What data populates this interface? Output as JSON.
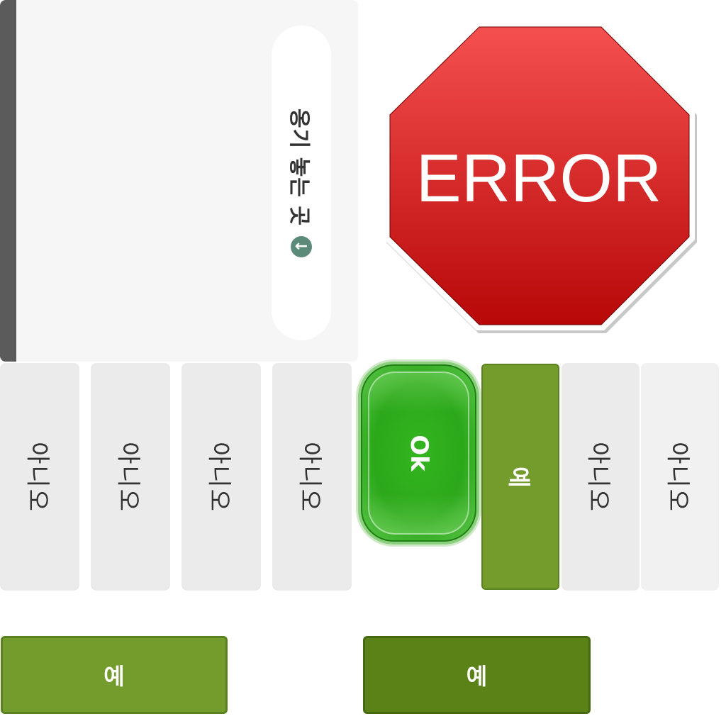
{
  "drop_zone": {
    "label": "옹기 놓는 곳",
    "arrow_icon": "arrow-left-circle-icon"
  },
  "error_sign": {
    "text": "ERROR",
    "color": "#d42a2a"
  },
  "tiles": {
    "no_label": "아니오",
    "ok_label": "Ok",
    "yes_label": "예"
  },
  "buttons": {
    "yes_left": "예",
    "yes_right": "예"
  },
  "colors": {
    "accent_green": "#739c2d",
    "dark_green": "#5a8216",
    "ok_green": "#2ca81a"
  }
}
